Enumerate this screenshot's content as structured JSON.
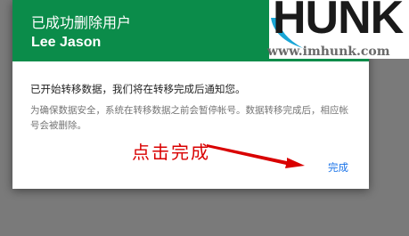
{
  "dialog": {
    "title": "已成功删除用户",
    "user_name": "Lee Jason",
    "message": "已开始转移数据，我们将在转移完成后通知您。",
    "note": "为确保数据安全，系统在转移数据之前会暂停帐号。数据转移完成后，相应帐号会被删除。",
    "done_label": "完成"
  },
  "annotation": {
    "text": "点击完成"
  },
  "watermark": {
    "logo": "HUNK",
    "url": "www.imhunk.com"
  },
  "colors": {
    "header": "#0b8c4a",
    "link": "#1a73e8",
    "annotation": "#d90000"
  }
}
